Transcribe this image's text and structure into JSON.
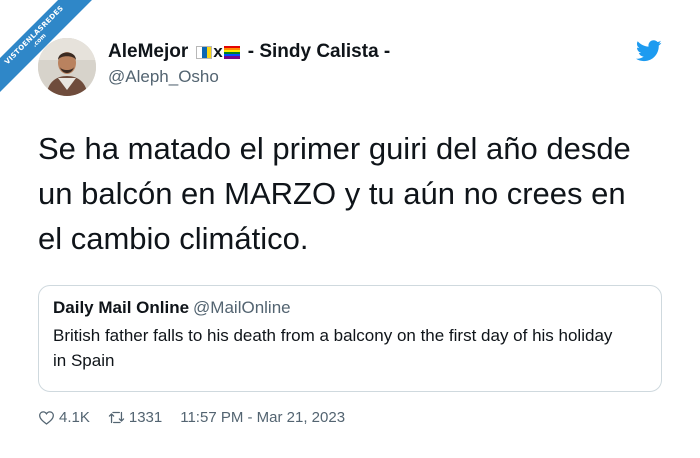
{
  "watermark": {
    "text": "VISTOENLASREDES",
    "suffix": ".com"
  },
  "author": {
    "name_prefix": "AleMejor",
    "name_x": "x",
    "name_suffix": "- Sindy Calista -",
    "handle": "@Aleph_Osho"
  },
  "tweet": {
    "text": "Se ha matado el primer guiri del año desde un balcón en MARZO y tu aún no crees en el cambio climático."
  },
  "quote": {
    "name": "Daily Mail Online",
    "handle": "@MailOnline",
    "text": "British father falls to his death from a balcony on the first day of his holiday in Spain"
  },
  "footer": {
    "likes": "4.1K",
    "retweets": "1331",
    "timestamp": "11:57 PM - Mar 21, 2023"
  },
  "icons": {
    "brand": "twitter-bird-icon",
    "like": "heart-icon",
    "retweet": "retweet-icon",
    "flag": "canary-islands-flag-icon",
    "pride": "rainbow-flag-icon"
  },
  "colors": {
    "brand": "#1d9bf0",
    "text": "#0f1419",
    "muted": "#536471",
    "border": "#cfd9de",
    "ribbon": "#2f87c8"
  }
}
